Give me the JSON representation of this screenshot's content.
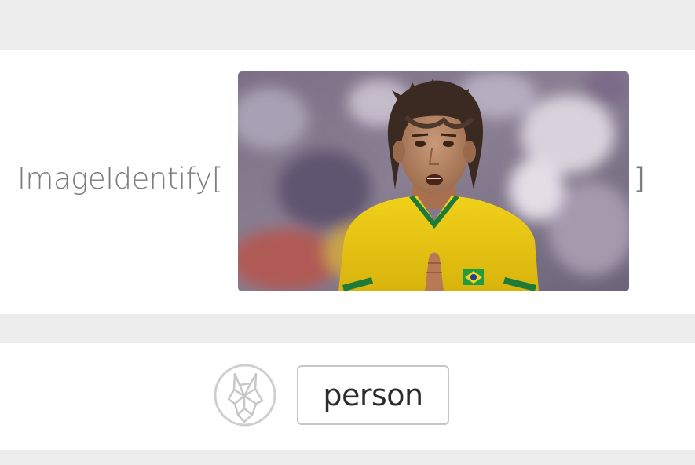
{
  "input": {
    "function_name": "ImageIdentify[",
    "closing_bracket": "]",
    "image": {
      "subject": "portrait photo of a football player in a yellow jersey"
    }
  },
  "output": {
    "icon": "wolf-logo-icon",
    "result": "person"
  },
  "colors": {
    "background": "#ededed",
    "panel": "#ffffff",
    "code_text": "#7d7d7d",
    "result_border": "#c6c6c6",
    "result_text": "#2b2b2b"
  }
}
